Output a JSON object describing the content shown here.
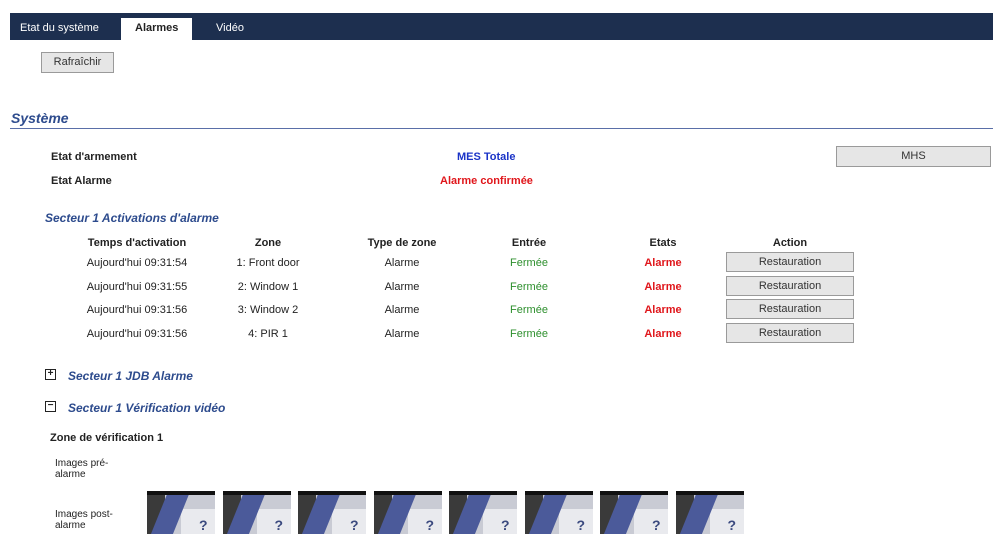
{
  "tabs": [
    {
      "label": "Etat du système",
      "active": false
    },
    {
      "label": "Alarmes",
      "active": true
    },
    {
      "label": "Vidéo",
      "active": false
    }
  ],
  "refresh_label": "Rafraîchir",
  "system": {
    "title": "Système",
    "arming_label": "Etat d'armement",
    "arming_value": "MES Totale",
    "alarm_label": "Etat Alarme",
    "alarm_value": "Alarme confirmée",
    "mhs_label": "MHS"
  },
  "activations": {
    "title": "Secteur 1 Activations d'alarme",
    "headers": {
      "time": "Temps d'activation",
      "zone": "Zone",
      "type": "Type de zone",
      "input": "Entrée",
      "states": "Etats",
      "action": "Action"
    },
    "rows": [
      {
        "time": "Aujourd'hui 09:31:54",
        "zone": "1: Front door",
        "type": "Alarme",
        "input": "Fermée",
        "state": "Alarme",
        "action": "Restauration"
      },
      {
        "time": "Aujourd'hui 09:31:55",
        "zone": "2: Window 1",
        "type": "Alarme",
        "input": "Fermée",
        "state": "Alarme",
        "action": "Restauration"
      },
      {
        "time": "Aujourd'hui 09:31:56",
        "zone": "3: Window 2",
        "type": "Alarme",
        "input": "Fermée",
        "state": "Alarme",
        "action": "Restauration"
      },
      {
        "time": "Aujourd'hui 09:31:56",
        "zone": "4: PIR 1",
        "type": "Alarme",
        "input": "Fermée",
        "state": "Alarme",
        "action": "Restauration"
      }
    ]
  },
  "log": {
    "title": "Secteur 1 JDB Alarme",
    "toggle": "+"
  },
  "video": {
    "title": "Secteur 1 Vérification vidéo",
    "toggle": "−",
    "zone_title": "Zone de vérification 1",
    "pre_label": "Images pré-alarme",
    "post_label": "Images post-alarme",
    "thumb_count": 8
  },
  "colors": {
    "header_bg": "#1d2f4f",
    "section_title": "#2d4b8d",
    "armed": "#1a33c7",
    "alarm": "#e0161b",
    "closed": "#2d8f2d"
  }
}
